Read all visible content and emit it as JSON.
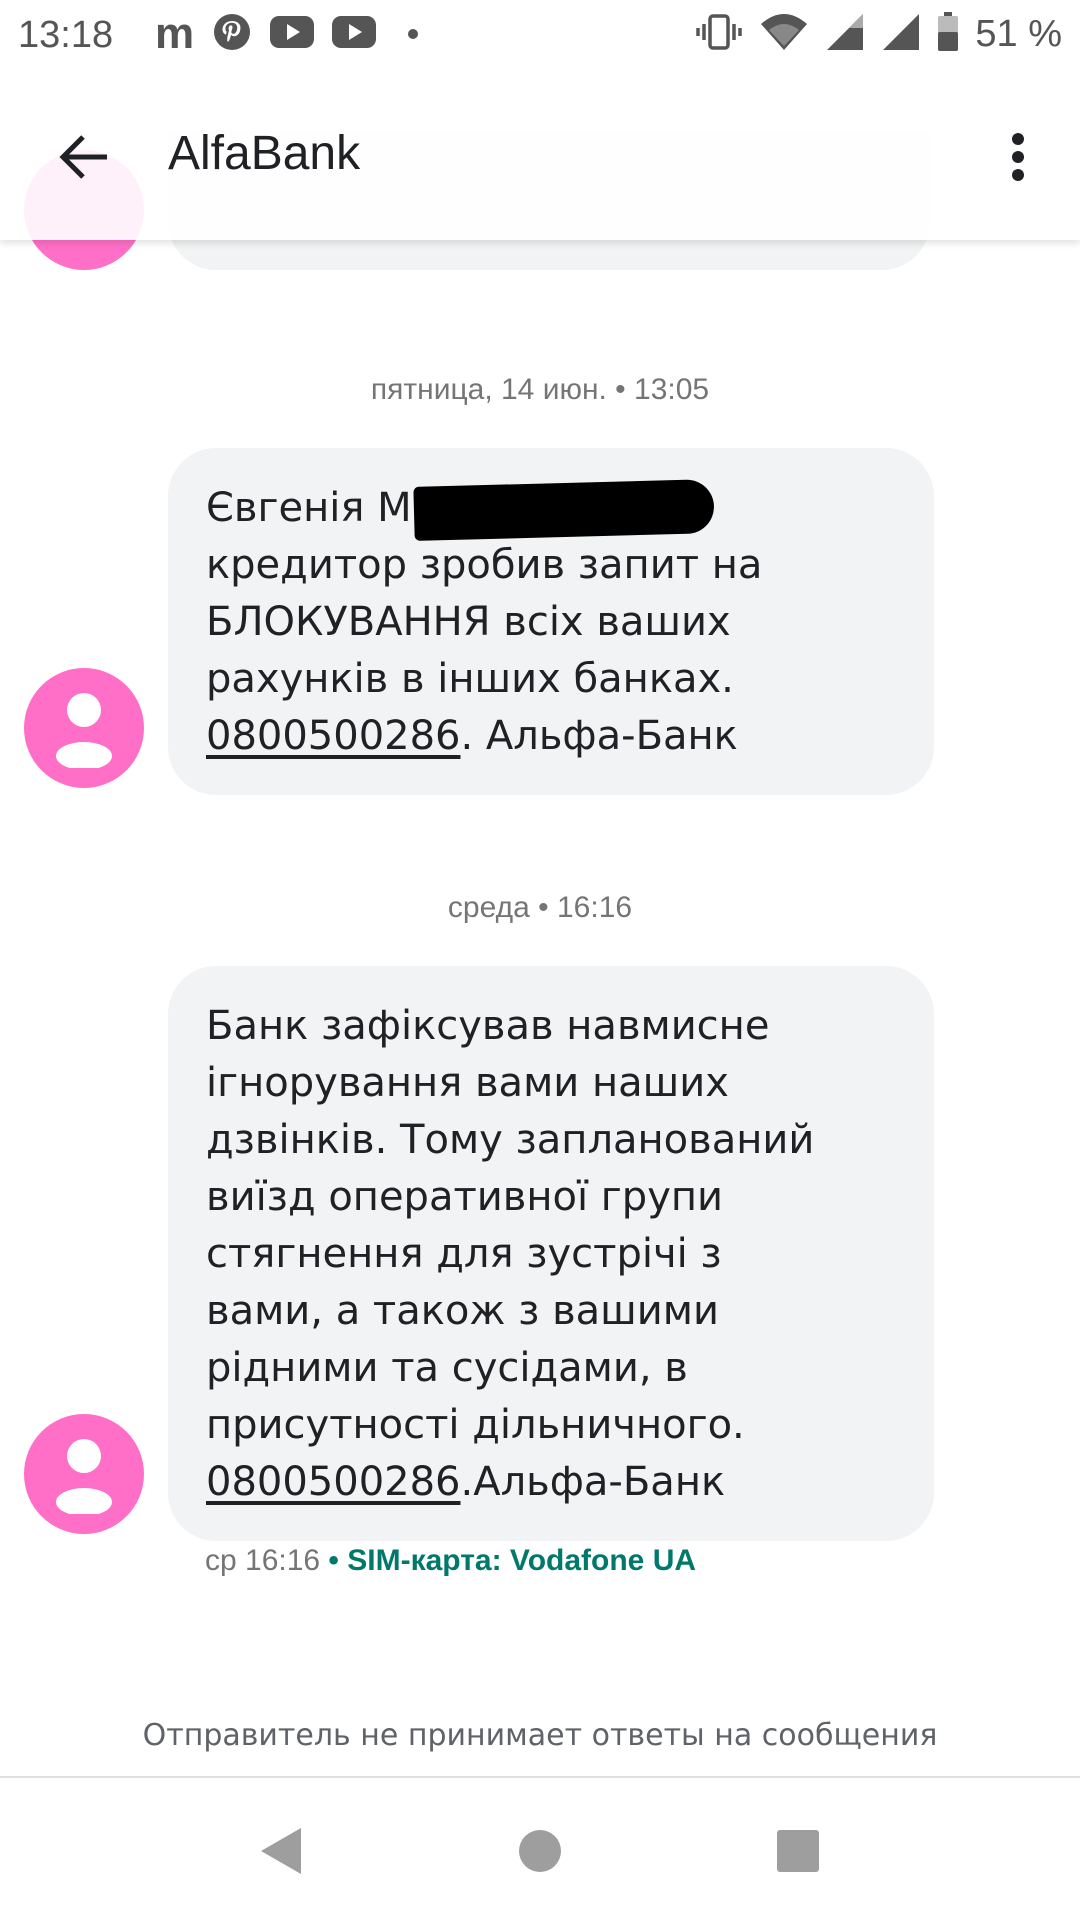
{
  "status_bar": {
    "time": "13:18",
    "notification_letter": "m",
    "battery_percent": "51 %",
    "icons": [
      "m-app-icon",
      "pinterest-icon",
      "youtube-icon",
      "youtube-icon",
      "more-notifications-dot",
      "vibrate-icon",
      "wifi-icon",
      "signal-icon",
      "signal-icon",
      "battery-icon"
    ]
  },
  "app_bar": {
    "title": "AlfaBank",
    "back_icon": "arrow-back-icon",
    "menu_icon": "more-vert-icon"
  },
  "conversation": {
    "messages": [
      {
        "date_separator": "пятница, 14 июн. • 13:05",
        "lines": [
          "Євгенія М",
          "кредитор зробив запит на",
          "БЛОКУВАННЯ всіх ваших",
          "рахунків в інших банках."
        ],
        "phone": "0800500286",
        "suffix": ". Альфа-Банк",
        "redacted": true
      },
      {
        "date_separator": "среда • 16:16",
        "lines": [
          "Банк зафіксував навмисне",
          "ігнорування вами наших",
          "дзвінків. Тому запланований",
          "виїзд оперативної групи",
          "стягнення для зустрічі з",
          "вами, а також з вашими",
          "рідними та сусідами, в",
          "присутності дільничного."
        ],
        "phone": "0800500286",
        "suffix": ".Альфа-Банк",
        "meta_time": "ср 16:16",
        "meta_sim": " • SIM-карта: Vodafone UA"
      }
    ],
    "no_reply_notice": "Отправитель не принимает ответы на сообщения"
  },
  "nav_bar": {
    "buttons": [
      "back-triangle-icon",
      "home-circle-icon",
      "recents-square-icon"
    ]
  },
  "colors": {
    "avatar": "#ff6fc8",
    "bubble": "#f1f3f4",
    "sim_text": "#00796b",
    "meta_text": "#757575"
  }
}
